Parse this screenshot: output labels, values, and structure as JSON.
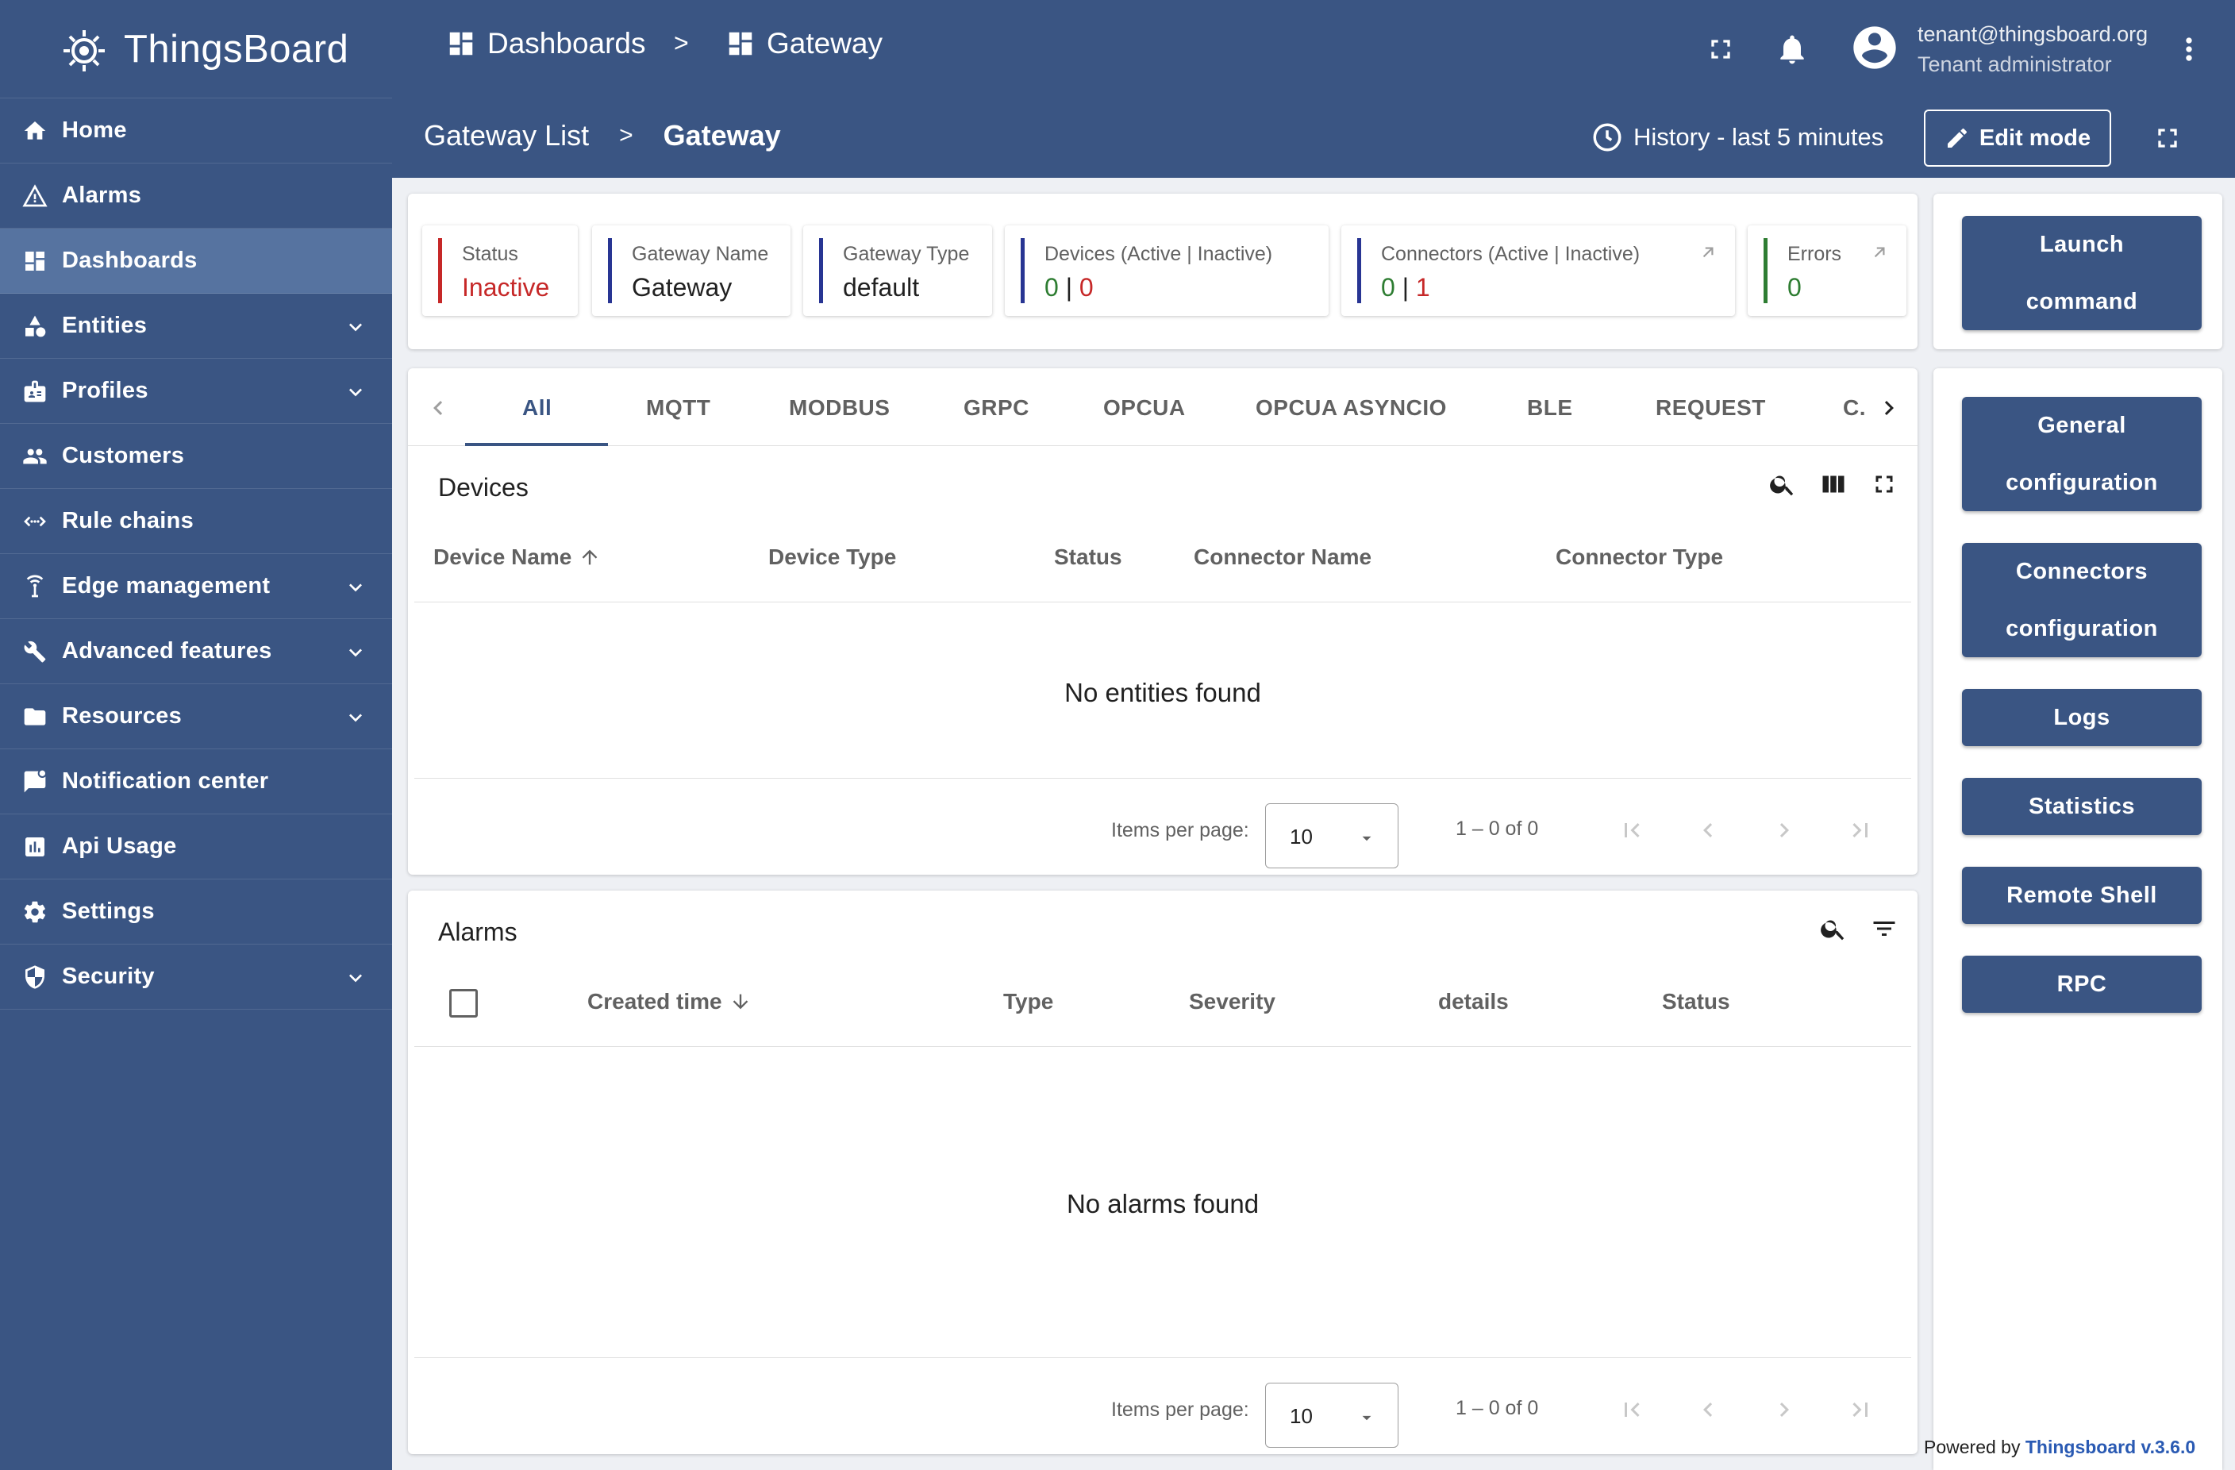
{
  "app": {
    "brand": "ThingsBoard"
  },
  "topbar": {
    "crumbs": [
      {
        "label": "Dashboards",
        "icon": "dashboard-icon"
      },
      {
        "label": "Gateway",
        "icon": "dashboard-icon"
      }
    ],
    "separator": ">",
    "user": {
      "email": "tenant@thingsboard.org",
      "role": "Tenant administrator"
    }
  },
  "sidebar": {
    "items": [
      {
        "label": "Home",
        "icon": "home-icon",
        "expandable": false
      },
      {
        "label": "Alarms",
        "icon": "warning-icon",
        "expandable": false
      },
      {
        "label": "Dashboards",
        "icon": "dashboard-icon",
        "expandable": false,
        "active": true
      },
      {
        "label": "Entities",
        "icon": "entities-icon",
        "expandable": true
      },
      {
        "label": "Profiles",
        "icon": "profiles-icon",
        "expandable": true
      },
      {
        "label": "Customers",
        "icon": "customers-icon",
        "expandable": false
      },
      {
        "label": "Rule chains",
        "icon": "rule-chains-icon",
        "expandable": false
      },
      {
        "label": "Edge management",
        "icon": "edge-icon",
        "expandable": true
      },
      {
        "label": "Advanced features",
        "icon": "tools-icon",
        "expandable": true
      },
      {
        "label": "Resources",
        "icon": "folder-icon",
        "expandable": true
      },
      {
        "label": "Notification center",
        "icon": "notification-icon",
        "expandable": false
      },
      {
        "label": "Api Usage",
        "icon": "chart-icon",
        "expandable": false
      },
      {
        "label": "Settings",
        "icon": "gear-icon",
        "expandable": false
      },
      {
        "label": "Security",
        "icon": "shield-icon",
        "expandable": true
      }
    ]
  },
  "subbar": {
    "crumb_parent": "Gateway List",
    "separator": ">",
    "crumb_current": "Gateway",
    "history": "History - last 5 minutes",
    "edit_mode": "Edit mode"
  },
  "stats": {
    "status": {
      "label": "Status",
      "value": "Inactive",
      "color": "#c62828"
    },
    "gateway_name": {
      "label": "Gateway Name",
      "value": "Gateway"
    },
    "gateway_type": {
      "label": "Gateway Type",
      "value": "default"
    },
    "devices": {
      "label": "Devices (Active | Inactive)",
      "active": "0",
      "sep": " | ",
      "inactive": "0"
    },
    "connectors": {
      "label": "Connectors (Active | Inactive)",
      "active": "0",
      "sep": " | ",
      "inactive": "1"
    },
    "errors": {
      "label": "Errors",
      "value": "0"
    },
    "colors": {
      "red": "#c62828",
      "blue": "#3a5583",
      "green": "#2e7d32",
      "navy": "#283593"
    }
  },
  "tabs": [
    "All",
    "MQTT",
    "MODBUS",
    "GRPC",
    "OPCUA",
    "OPCUA ASYNCIO",
    "BLE",
    "REQUEST",
    "C."
  ],
  "devices": {
    "title": "Devices",
    "columns": [
      "Device Name",
      "Device Type",
      "Status",
      "Connector Name",
      "Connector Type"
    ],
    "empty": "No entities found",
    "pager": {
      "items_per_page": "Items per page:",
      "page_size": "10",
      "range": "1 – 0 of 0"
    }
  },
  "alarms": {
    "title": "Alarms",
    "columns": [
      "Created time",
      "Type",
      "Severity",
      "details",
      "Status"
    ],
    "empty": "No alarms found",
    "pager": {
      "items_per_page": "Items per page:",
      "page_size": "10",
      "range": "1 – 0 of 0"
    }
  },
  "actions": {
    "launch_command": [
      "Launch",
      "command"
    ],
    "general_configuration": [
      "General",
      "configuration"
    ],
    "connectors_configuration": [
      "Connectors",
      "configuration"
    ],
    "logs": "Logs",
    "statistics": "Statistics",
    "remote_shell": "Remote Shell",
    "rpc": "RPC"
  },
  "footer": {
    "powered_by": "Powered by ",
    "link": "Thingsboard v.3.6.0"
  }
}
